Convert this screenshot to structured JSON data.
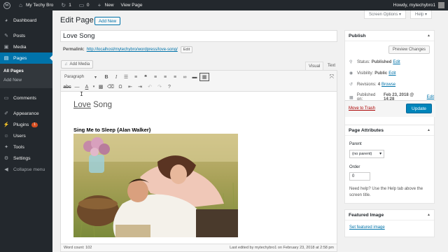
{
  "adminbar": {
    "site_name": "My Techy Bro",
    "updates_count": "1",
    "comments_count": "0",
    "new_label": "New",
    "view_page_label": "View Page",
    "howdy": "Howdy, mytechybro1"
  },
  "sidebar": {
    "items": [
      {
        "label": "Dashboard",
        "icon": "dashboard-icon"
      },
      {
        "label": "Posts",
        "icon": "pin-icon"
      },
      {
        "label": "Media",
        "icon": "media-icon"
      },
      {
        "label": "Pages",
        "icon": "pages-icon"
      },
      {
        "label": "Comments",
        "icon": "comment-icon"
      },
      {
        "label": "Appearance",
        "icon": "paintbrush-icon"
      },
      {
        "label": "Plugins",
        "icon": "plugin-icon",
        "badge": "1"
      },
      {
        "label": "Users",
        "icon": "users-icon"
      },
      {
        "label": "Tools",
        "icon": "wrench-icon"
      },
      {
        "label": "Settings",
        "icon": "settings-icon"
      },
      {
        "label": "Collapse menu",
        "icon": "collapse-icon"
      }
    ],
    "submenu": [
      "All Pages",
      "Add New"
    ]
  },
  "screen_options_label": "Screen Options ▾",
  "help_label": "Help ▾",
  "page_heading": "Edit Page",
  "add_new_label": "Add New",
  "title_value": "Love Song",
  "permalink": {
    "label": "Permalink:",
    "url": "http://localhost/mytechybro/wordpress/love-song/",
    "edit_label": "Edit"
  },
  "add_media_label": "Add Media",
  "editor_tabs": {
    "visual": "Visual",
    "text": "Text"
  },
  "format_select": "Paragraph",
  "content": {
    "heading_word1": "Love",
    "heading_word2": " Song",
    "subheading": "Sing Me to Sleep {Alan Walker}"
  },
  "status": {
    "word_count": "Word count: 102",
    "last_edited": "Last edited by mytechybro1 on February 23, 2018 at 2:58 pm"
  },
  "publish": {
    "title": "Publish",
    "preview_label": "Preview Changes",
    "status_label": "Status:",
    "status_value": "Published",
    "visibility_label": "Visibility:",
    "visibility_value": "Public",
    "revisions_label": "Revisions:",
    "revisions_value": "4",
    "browse_label": "Browse",
    "published_label": "Published on:",
    "published_value": "Feb 23, 2018 @ 14:28",
    "edit_label": "Edit",
    "trash_label": "Move to Trash",
    "update_label": "Update"
  },
  "page_attributes": {
    "title": "Page Attributes",
    "parent_label": "Parent",
    "parent_value": "(no parent)",
    "order_label": "Order",
    "order_value": "0",
    "help_text": "Need help? Use the Help tab above the screen title."
  },
  "featured_image": {
    "title": "Featured Image",
    "link": "Set featured image"
  },
  "colors": {
    "admin_dark": "#23282d",
    "accent_blue": "#0073aa",
    "update_blue": "#0085ba",
    "trash_red": "#a00",
    "badge_orange": "#d54e21"
  }
}
